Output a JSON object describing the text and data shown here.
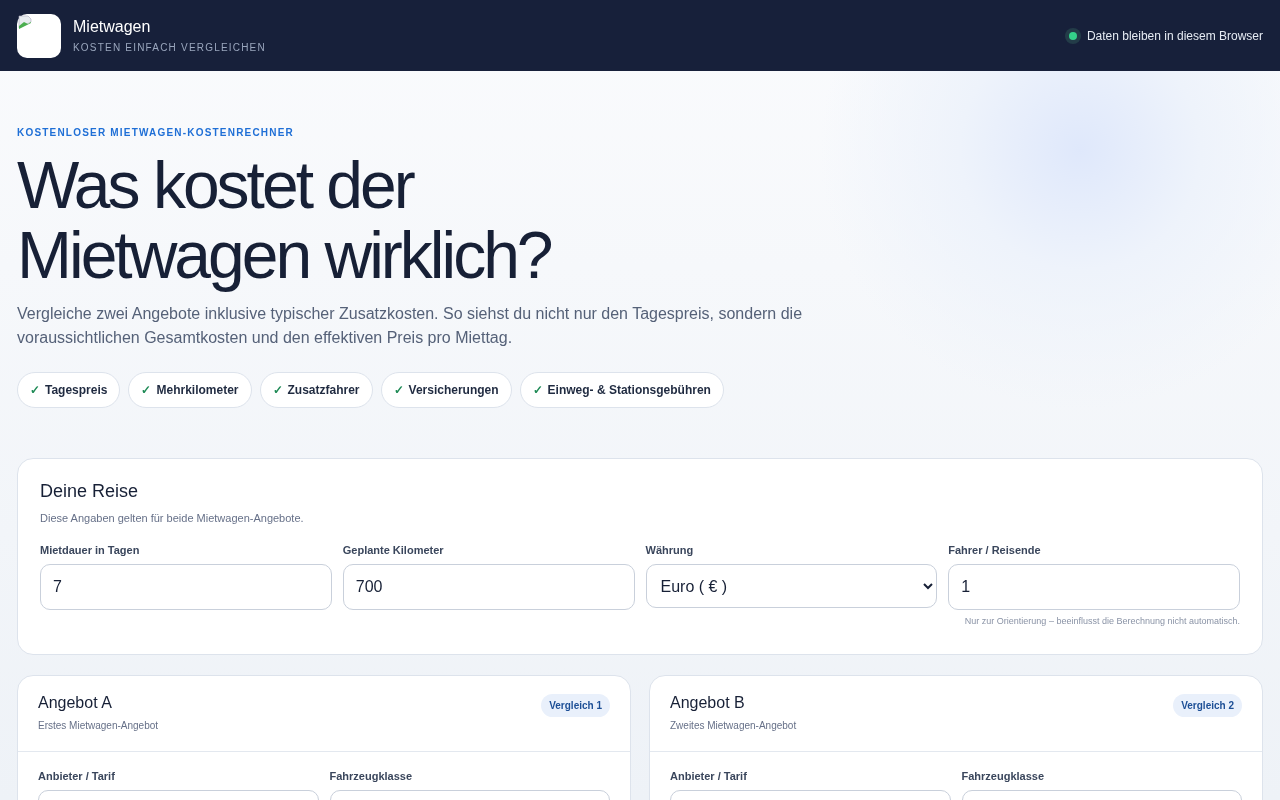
{
  "header": {
    "title": "Mietwagen",
    "subtitle": "KOSTEN EINFACH VERGLEICHEN",
    "status": "Daten bleiben in diesem Browser"
  },
  "hero": {
    "eyebrow": "KOSTENLOSER MIETWAGEN-KOSTENRECHNER",
    "title_lines": [
      "Was kostet der",
      "Mietwagen wirklich?"
    ],
    "lead": "Vergleiche zwei Angebote inklusive typischer Zusatzkosten. So siehst du nicht nur den Tagespreis, sondern die voraussichtlichen Gesamtkosten und den effektiven Preis pro Miettag.",
    "chips": [
      {
        "check": "✓",
        "label": "Tagespreis"
      },
      {
        "check": "✓",
        "label": "Mehrkilometer"
      },
      {
        "check": "✓",
        "label": "Zusatzfahrer"
      },
      {
        "check": "✓",
        "label": "Versicherungen"
      },
      {
        "check": "✓",
        "label": "Einweg- & Stationsgebühren"
      }
    ]
  },
  "trip": {
    "title": "Deine Reise",
    "subtitle": "Diese Angaben gelten für beide Mietwagen-Angebote.",
    "fields": [
      {
        "kind": "input",
        "label": "Mietdauer in Tagen",
        "value": "7"
      },
      {
        "kind": "input",
        "label": "Geplante Kilometer",
        "value": "700"
      },
      {
        "kind": "select",
        "label": "Währung",
        "value": "Euro ( € )"
      },
      {
        "kind": "input",
        "label": "Fahrer / Reisende",
        "value": "1",
        "hint": "Nur zur Orientierung – beeinflusst die Berechnung nicht automatisch."
      }
    ]
  },
  "offers": [
    {
      "title": "Angebot A",
      "subtitle": "Erstes Mietwagen-Angebot",
      "badge": "Vergleich 1",
      "fields": [
        "Anbieter / Tarif",
        "Fahrzeugklasse"
      ]
    },
    {
      "title": "Angebot B",
      "subtitle": "Zweites Mietwagen-Angebot",
      "badge": "Vergleich 2",
      "fields": [
        "Anbieter / Tarif",
        "Fahrzeugklasse"
      ]
    }
  ]
}
